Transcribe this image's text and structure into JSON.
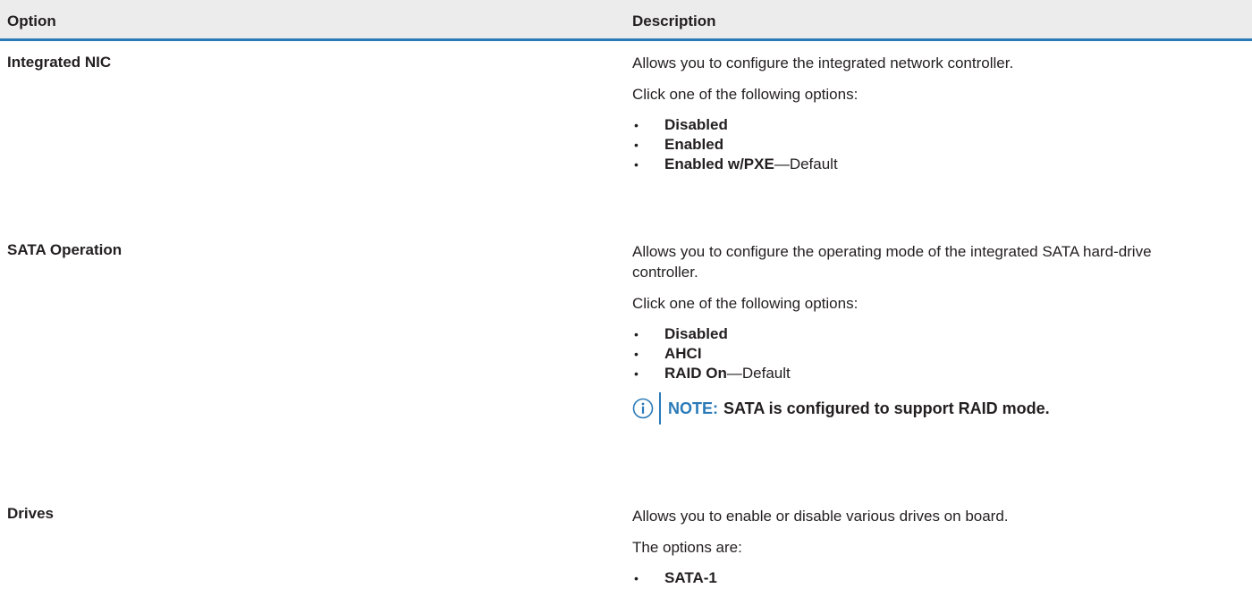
{
  "header": {
    "option": "Option",
    "description": "Description"
  },
  "rows": [
    {
      "option": "Integrated NIC",
      "description": "Allows you to configure the integrated network controller.",
      "prompt": "Click one of the following options:",
      "items": [
        {
          "label": "Disabled",
          "suffix": ""
        },
        {
          "label": "Enabled",
          "suffix": ""
        },
        {
          "label": "Enabled w/PXE",
          "suffix": "—Default"
        }
      ]
    },
    {
      "option": "SATA Operation",
      "description": "Allows you to configure the operating mode of the integrated SATA hard-drive controller.",
      "prompt": "Click one of the following options:",
      "items": [
        {
          "label": "Disabled",
          "suffix": ""
        },
        {
          "label": "AHCI",
          "suffix": ""
        },
        {
          "label": "RAID On",
          "suffix": "—Default"
        }
      ],
      "note": {
        "label": "NOTE:",
        "text": "SATA is configured to support RAID mode."
      }
    },
    {
      "option": "Drives",
      "description": "Allows you to enable or disable various drives on board.",
      "prompt": "The options are:",
      "items": [
        {
          "label": "SATA-1",
          "suffix": ""
        }
      ]
    }
  ],
  "colors": {
    "accent": "#2a7ab8",
    "header_bg": "#ececec",
    "text": "#231f20"
  },
  "icons": {
    "note": "info-circle-icon",
    "bullet": "bullet-dot"
  }
}
